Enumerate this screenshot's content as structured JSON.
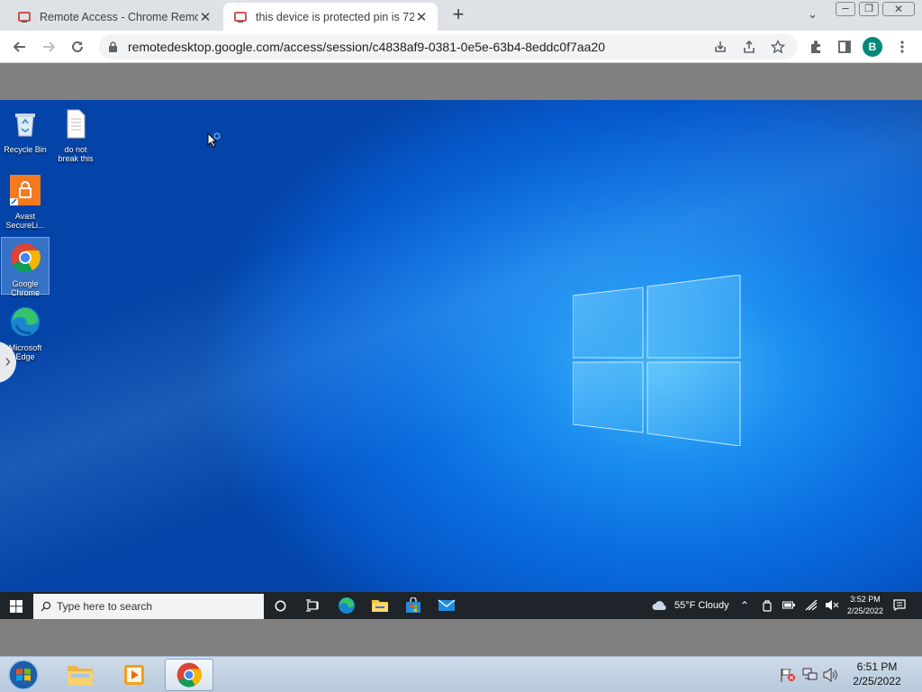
{
  "browser": {
    "tabs": [
      {
        "title": "Remote Access - Chrome Remote",
        "active": false
      },
      {
        "title": "this device is protected pin is 72",
        "active": true
      }
    ],
    "new_tab_label": "+",
    "url": "remotedesktop.google.com/access/session/c4838af9-0381-0e5e-63b4-8eddc0f7aa20",
    "profile_initial": "B",
    "accent": "#00897b"
  },
  "remote_desktop": {
    "icons": [
      {
        "label": "Recycle Bin",
        "icon": "recycle-bin-icon"
      },
      {
        "label": "do not break this",
        "icon": "text-file-icon"
      },
      {
        "label": "Avast SecureLi...",
        "icon": "avast-secureline-icon"
      },
      {
        "label": "Google Chrome",
        "icon": "chrome-icon"
      },
      {
        "label": "Microsoft Edge",
        "icon": "edge-icon"
      }
    ],
    "taskbar": {
      "search_placeholder": "Type here to search",
      "weather": "55°F  Cloudy",
      "time": "3:52 PM",
      "date": "2/25/2022"
    }
  },
  "host_taskbar": {
    "time": "6:51 PM",
    "date": "2/25/2022"
  }
}
